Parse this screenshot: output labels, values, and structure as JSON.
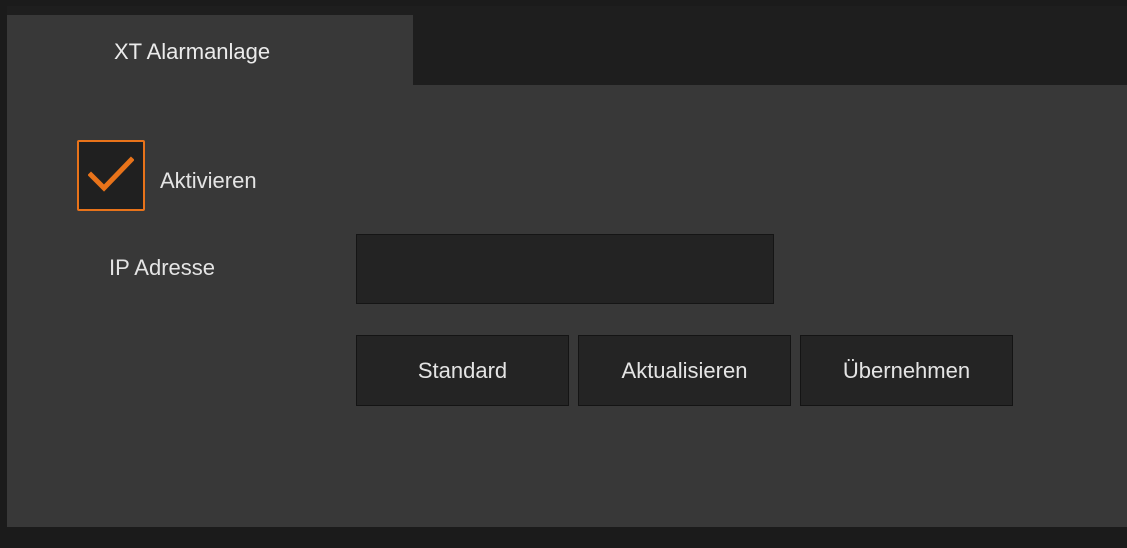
{
  "tab": {
    "label": "XT Alarmanlage"
  },
  "activate": {
    "label": "Aktivieren",
    "checked": true
  },
  "ip": {
    "label": "IP Adresse",
    "value": ""
  },
  "buttons": {
    "standard": "Standard",
    "refresh": "Aktualisieren",
    "apply": "Übernehmen"
  },
  "colors": {
    "accent": "#e8731a",
    "panel": "#383838",
    "background": "#1b1b1b",
    "control": "#242424"
  },
  "icons": {
    "checkbox": "checkmark-icon"
  }
}
